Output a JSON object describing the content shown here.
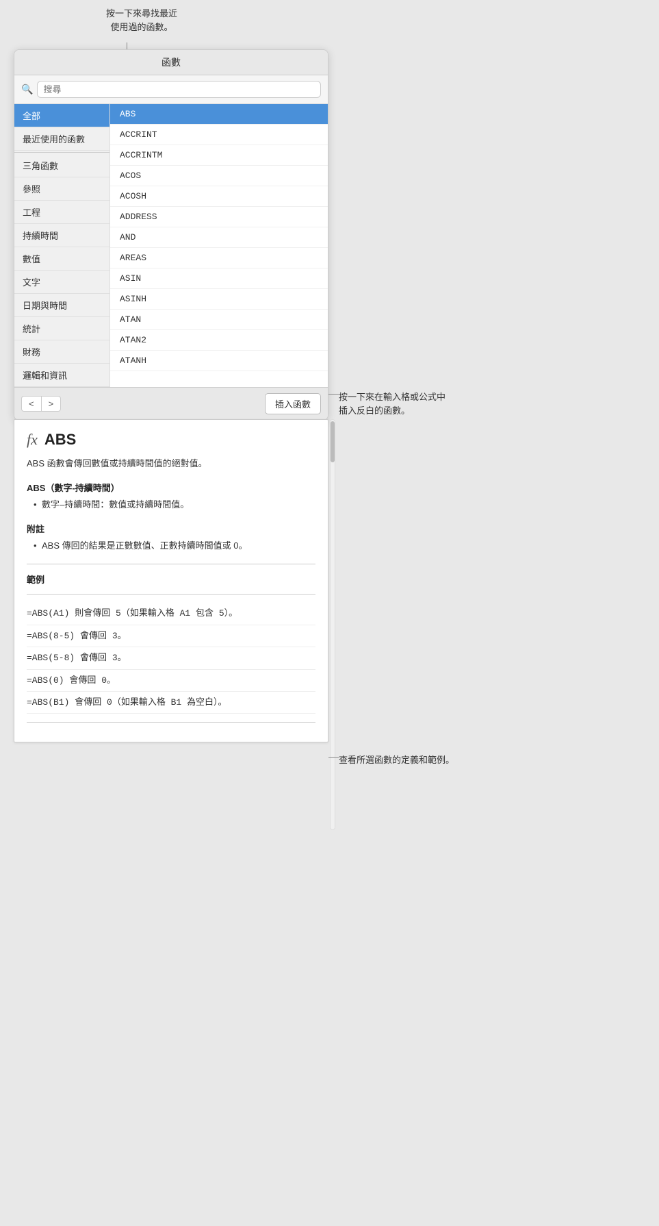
{
  "annotations": {
    "top_callout": "按一下來尋找最近\n使用過的函數。",
    "insert_callout": "按一下來在輸入格或公式中\n插入反白的函數。",
    "desc_callout": "查看所選函數的定義和範例。"
  },
  "panel": {
    "title": "函數",
    "search_placeholder": "搜尋"
  },
  "categories": [
    {
      "id": "all",
      "label": "全部",
      "selected": true
    },
    {
      "id": "recent",
      "label": "最近使用的函數",
      "selected": false
    },
    {
      "id": "trig",
      "label": "三角函數",
      "selected": false
    },
    {
      "id": "ref",
      "label": "參照",
      "selected": false
    },
    {
      "id": "eng",
      "label": "工程",
      "selected": false
    },
    {
      "id": "duration",
      "label": "持續時間",
      "selected": false
    },
    {
      "id": "numeric",
      "label": "數值",
      "selected": false
    },
    {
      "id": "text",
      "label": "文字",
      "selected": false
    },
    {
      "id": "datetime",
      "label": "日期與時間",
      "selected": false
    },
    {
      "id": "stats",
      "label": "統計",
      "selected": false
    },
    {
      "id": "finance",
      "label": "財務",
      "selected": false
    },
    {
      "id": "logic",
      "label": "邏輯和資訊",
      "selected": false
    }
  ],
  "functions": [
    {
      "name": "ABS",
      "selected": true
    },
    {
      "name": "ACCRINT",
      "selected": false
    },
    {
      "name": "ACCRINTM",
      "selected": false
    },
    {
      "name": "ACOS",
      "selected": false
    },
    {
      "name": "ACOSH",
      "selected": false
    },
    {
      "name": "ADDRESS",
      "selected": false
    },
    {
      "name": "AND",
      "selected": false
    },
    {
      "name": "AREAS",
      "selected": false
    },
    {
      "name": "ASIN",
      "selected": false
    },
    {
      "name": "ASINH",
      "selected": false
    },
    {
      "name": "ATAN",
      "selected": false
    },
    {
      "name": "ATAN2",
      "selected": false
    },
    {
      "name": "ATANH",
      "selected": false
    }
  ],
  "bottom_bar": {
    "prev_btn": "<",
    "next_btn": ">",
    "insert_btn": "插入函數"
  },
  "description": {
    "fx_symbol": "fx",
    "func_name": "ABS",
    "desc": "ABS 函數會傳回數值或持續時間值的絕對值。",
    "syntax": "ABS（數字-持續時間）",
    "params": [
      "數字–持續時間：數值或持續時間值。"
    ],
    "notes_label": "附註",
    "notes": [
      "ABS 傳回的結果是正數數值、正數持續時間值或 0。"
    ],
    "examples_label": "範例",
    "examples": [
      "=ABS(A1) 則會傳回 5（如果輸入格 A1 包含 5）。",
      "=ABS(8-5) 會傳回 3。",
      "=ABS(5-8) 會傳回 3。",
      "=ABS(0) 會傳回 0。",
      "=ABS(B1) 會傳回 0（如果輸入格 B1 為空白）。"
    ]
  }
}
